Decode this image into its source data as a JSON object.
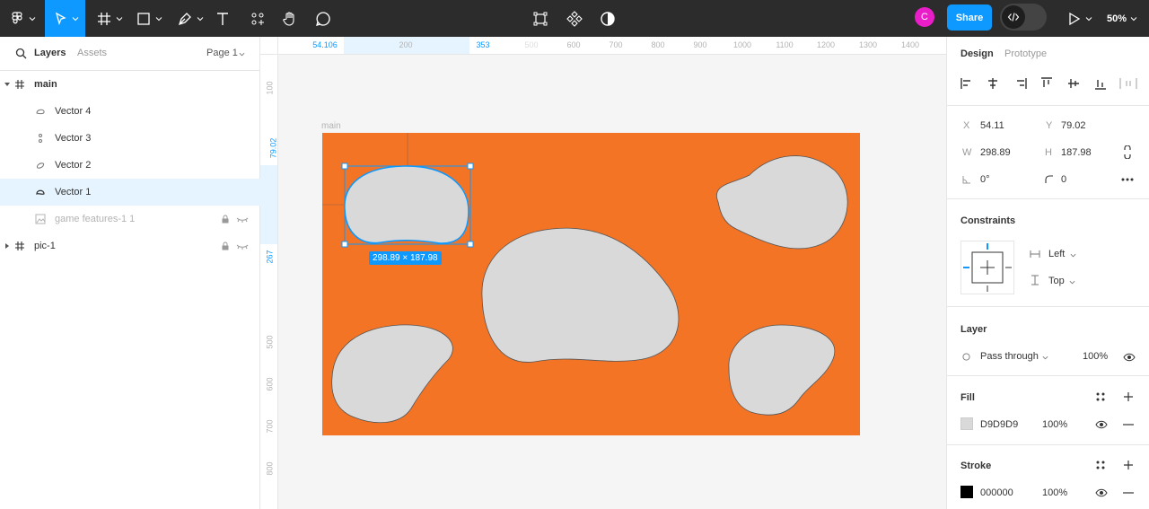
{
  "toolbar": {
    "icons": [
      "figma-menu-icon",
      "move-tool-icon",
      "frame-tool-icon",
      "shape-tool-icon",
      "pen-tool-icon",
      "text-tool-icon",
      "resources-icon",
      "hand-tool-icon",
      "comment-icon",
      "component-icon",
      "instance-icon",
      "contrast-icon",
      "play-icon"
    ],
    "share_label": "Share",
    "avatar_letter": "C",
    "avatar_color": "#e91ec9",
    "accent": "#0d99ff",
    "zoom": "50%"
  },
  "left_panel": {
    "tab_layers": "Layers",
    "tab_assets": "Assets",
    "page": "Page 1",
    "layers": [
      {
        "name": "main",
        "icon": "frame-icon"
      },
      {
        "name": "Vector 4",
        "icon": "vector-icon"
      },
      {
        "name": "Vector 3",
        "icon": "vector-icon"
      },
      {
        "name": "Vector 2",
        "icon": "vector-icon"
      },
      {
        "name": "Vector 1",
        "icon": "vector-icon",
        "selected": true
      },
      {
        "name": "game features-1 1",
        "icon": "image-icon",
        "hidden": true
      },
      {
        "name": "pic-1",
        "icon": "frame-icon"
      }
    ]
  },
  "rulers": {
    "top": [
      "54.106",
      "200",
      "353",
      "500",
      "600",
      "700",
      "800",
      "900",
      "1000",
      "1100",
      "1200",
      "1300",
      "1400"
    ],
    "left": [
      "100",
      "79.02",
      "267",
      "500",
      "600",
      "700",
      "800"
    ]
  },
  "canvas": {
    "frame_label": "main",
    "frame_color": "#f47425",
    "blob_color": "#d9d9d9",
    "size_badge": "298.89 × 187.98"
  },
  "right_panel": {
    "tab_design": "Design",
    "tab_prototype": "Prototype",
    "x_label": "X",
    "x": "54.11",
    "y_label": "Y",
    "y": "79.02",
    "w_label": "W",
    "w": "298.89",
    "h_label": "H",
    "h": "187.98",
    "rotation": "0°",
    "radius": "0",
    "constraints_title": "Constraints",
    "constraint_h": "Left",
    "constraint_v": "Top",
    "layer_title": "Layer",
    "blend": "Pass through",
    "opacity": "100%",
    "fill_title": "Fill",
    "fill_hex": "D9D9D9",
    "fill_swatch": "#d9d9d9",
    "fill_opacity": "100%",
    "stroke_title": "Stroke",
    "stroke_hex": "000000",
    "stroke_swatch": "#000000",
    "stroke_opacity": "100%"
  }
}
